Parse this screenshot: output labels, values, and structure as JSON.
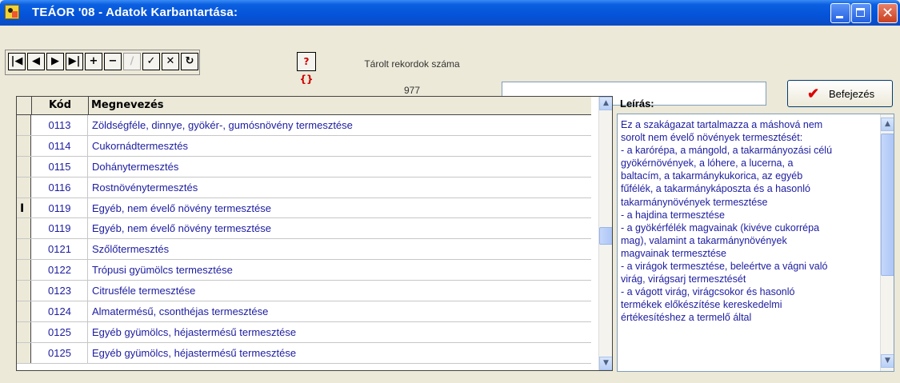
{
  "window": {
    "title": "TEÁOR '08 - Adatok Karbantartása:"
  },
  "toolbar": {
    "nav_buttons": [
      {
        "name": "first-record-button",
        "glyph": "⏮"
      },
      {
        "name": "prev-record-button",
        "glyph": "◀"
      },
      {
        "name": "next-record-button",
        "glyph": "▶"
      },
      {
        "name": "last-record-button",
        "glyph": "⏭"
      },
      {
        "name": "insert-record-button",
        "glyph": "+"
      },
      {
        "name": "delete-record-button",
        "glyph": "−"
      },
      {
        "name": "edit-record-button",
        "glyph": "∕"
      },
      {
        "name": "post-record-button",
        "glyph": "✓"
      },
      {
        "name": "cancel-edit-button",
        "glyph": "✕"
      },
      {
        "name": "refresh-button",
        "glyph": "↻"
      }
    ],
    "help_label": "?{}",
    "records_label": "Tárolt rekordok száma",
    "records_count": "977",
    "search_value": "",
    "finish_label": "Befejezés"
  },
  "grid": {
    "columns": {
      "code": "Kód",
      "name": "Megnevezés"
    },
    "rows": [
      {
        "code": "0113",
        "name": "Zöldségféle, dinnye, gyökér-, gumósnövény termesztése"
      },
      {
        "code": "0114",
        "name": "Cukornádtermesztés"
      },
      {
        "code": "0115",
        "name": "Dohánytermesztés"
      },
      {
        "code": "0116",
        "name": "Rostnövénytermesztés"
      },
      {
        "code": "0119",
        "name": "Egyéb, nem évelő növény termesztése",
        "current": true
      },
      {
        "code": "0119",
        "name": "Egyéb, nem évelő növény termesztése"
      },
      {
        "code": "0121",
        "name": "Szőlőtermesztés"
      },
      {
        "code": "0122",
        "name": "Trópusi gyümölcs termesztése"
      },
      {
        "code": "0123",
        "name": "Citrusféle termesztése"
      },
      {
        "code": "0124",
        "name": "Almatermésű, csonthéjas termesztése"
      },
      {
        "code": "0125",
        "name": "Egyéb gyümölcs, héjastermésű termesztése"
      },
      {
        "code": "0125",
        "name": "Egyéb gyümölcs, héjastermésű termesztése"
      }
    ]
  },
  "description": {
    "label": "Leírás:",
    "text": "Ez a szakágazat tartalmazza a máshová nem\nsorolt nem évelő növények termesztését:\n- a karórépa, a mángold, a takarmányozási célú\ngyökérnövények, a lóhere, a lucerna, a\nbaltacím, a takarmánykukorica, az egyéb\nfűfélék, a takarmánykáposzta és a hasonló\ntakarmánynövények termesztése\n- a hajdina termesztése\n- a gyökérfélék magvainak (kivéve cukorrépa\nmag), valamint a takarmánynövények\nmagvainak termesztése\n- a virágok termesztése, beleértve a vágni való\nvirág, virágsarj termesztését\n- a vágott virág, virágcsokor és hasonló\ntermékek előkészítése kereskedelmi\nértékesítéshez a termelő által"
  },
  "colors": {
    "title_bar": "#0553d8",
    "text_blue": "#1c1ca0",
    "face": "#ece9d8"
  }
}
